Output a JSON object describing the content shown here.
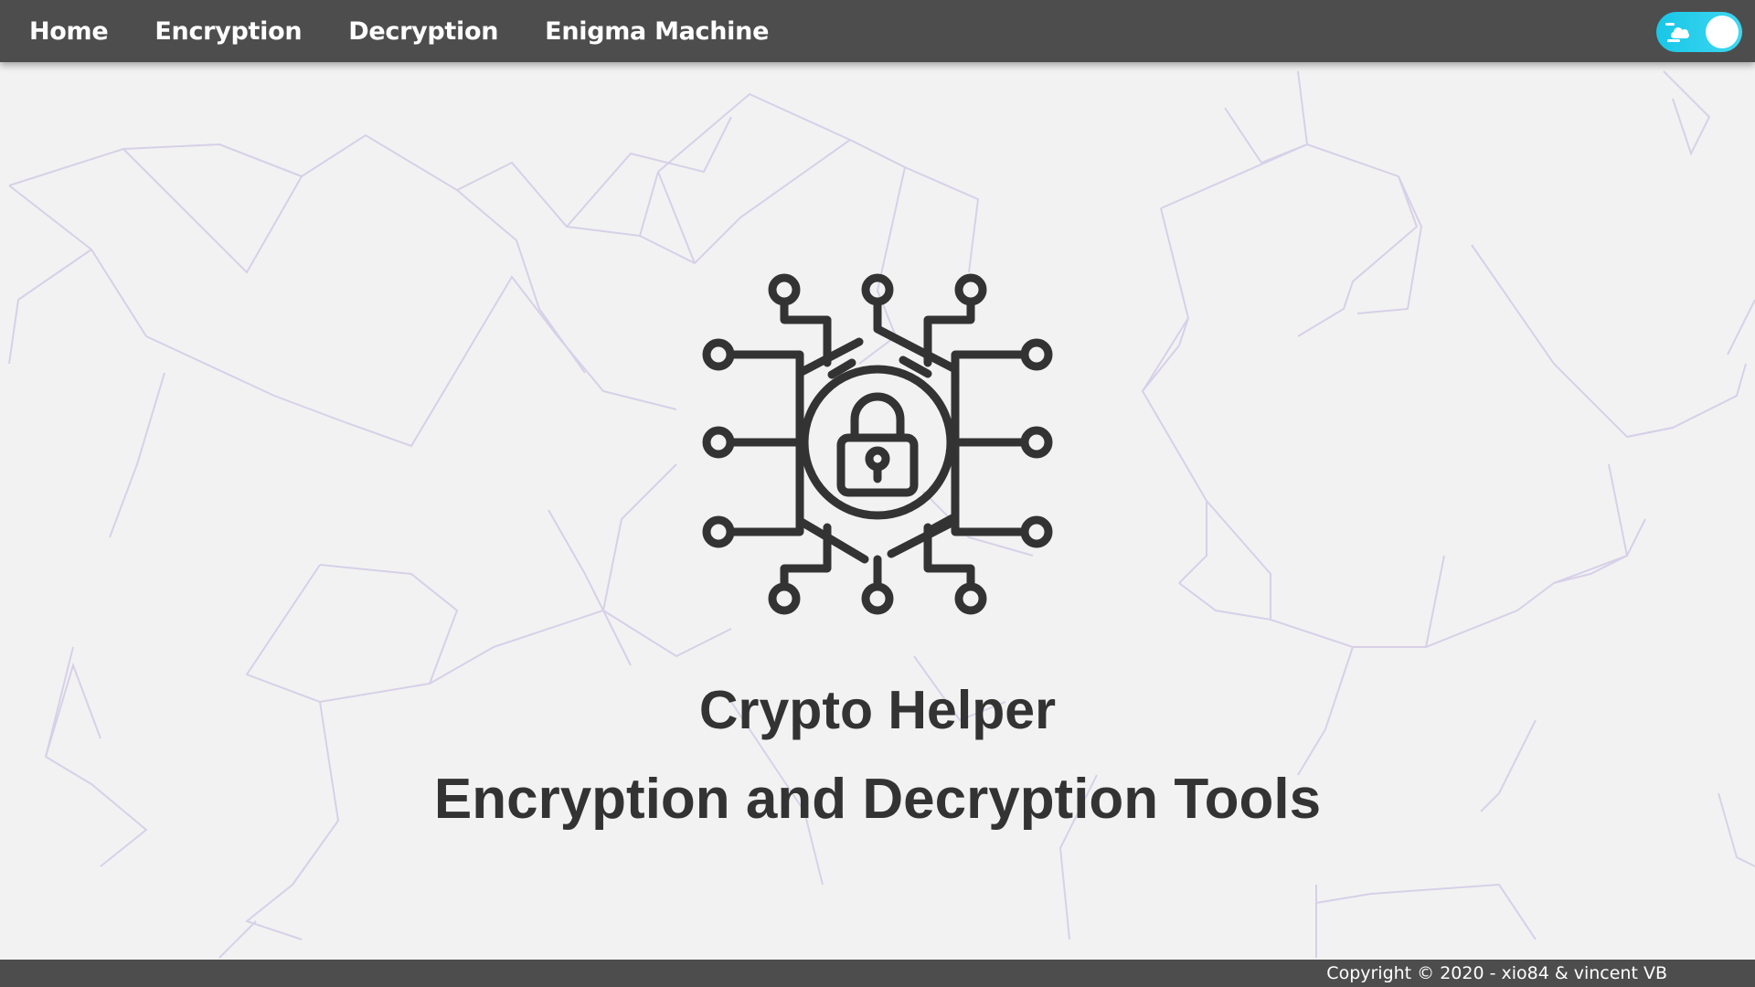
{
  "nav": {
    "items": [
      {
        "label": "Home"
      },
      {
        "label": "Encryption"
      },
      {
        "label": "Decryption"
      },
      {
        "label": "Enigma Machine"
      }
    ]
  },
  "theme_toggle": {
    "state": "on",
    "icon": "cloud-icon",
    "accent": "#1fcbe8"
  },
  "hero": {
    "icon": "cyber-lock-circuit-icon",
    "title": "Crypto Helper",
    "subtitle": "Encryption and Decryption Tools"
  },
  "footer": {
    "copyright": "Copyright © 2020 - xio84 & vincent VB"
  },
  "colors": {
    "navbar": "#4d4d4d",
    "background": "#f2f2f2",
    "text": "#333333",
    "network_lines": "#c9bfe3"
  }
}
